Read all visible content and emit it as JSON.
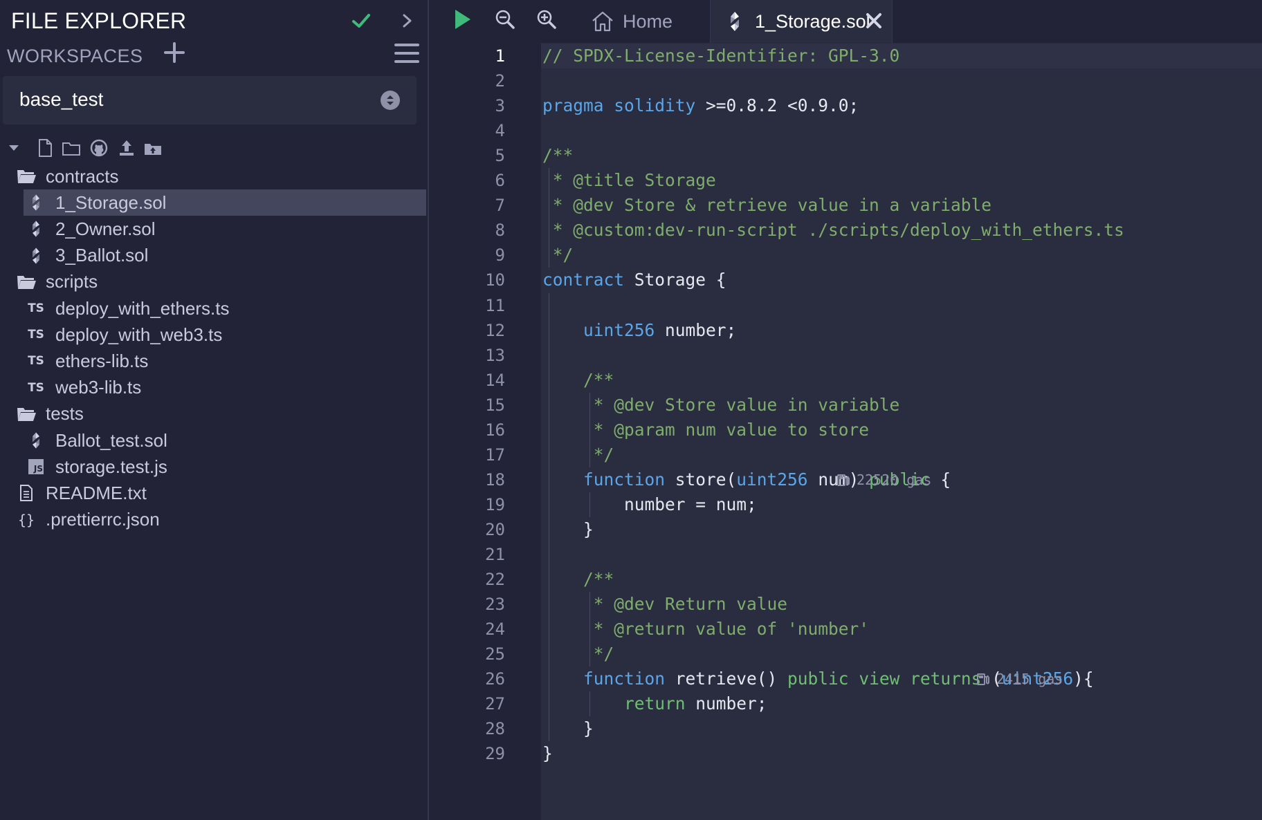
{
  "sidebar": {
    "title": "FILE EXPLORER",
    "workspaces_label": "WORKSPACES",
    "workspace_selected": "base_test",
    "tree": [
      {
        "label": "contracts",
        "type": "folder",
        "depth": 0
      },
      {
        "label": "1_Storage.sol",
        "type": "sol",
        "depth": 1,
        "selected": true
      },
      {
        "label": "2_Owner.sol",
        "type": "sol",
        "depth": 1
      },
      {
        "label": "3_Ballot.sol",
        "type": "sol",
        "depth": 1
      },
      {
        "label": "scripts",
        "type": "folder",
        "depth": 0
      },
      {
        "label": "deploy_with_ethers.ts",
        "type": "ts",
        "depth": 1
      },
      {
        "label": "deploy_with_web3.ts",
        "type": "ts",
        "depth": 1
      },
      {
        "label": "ethers-lib.ts",
        "type": "ts",
        "depth": 1
      },
      {
        "label": "web3-lib.ts",
        "type": "ts",
        "depth": 1
      },
      {
        "label": "tests",
        "type": "folder",
        "depth": 0
      },
      {
        "label": "Ballot_test.sol",
        "type": "sol",
        "depth": 1
      },
      {
        "label": "storage.test.js",
        "type": "js",
        "depth": 1
      },
      {
        "label": "README.txt",
        "type": "txt",
        "depth": 0
      },
      {
        "label": ".prettierrc.json",
        "type": "json",
        "depth": 0
      }
    ]
  },
  "tabs": {
    "home": "Home",
    "active": "1_Storage.sol"
  },
  "editor": {
    "active_line": 1,
    "gas_18": "22520 gas",
    "gas_26": "2415 gas",
    "lines": [
      "// SPDX-License-Identifier: GPL-3.0",
      "",
      "pragma solidity >=0.8.2 <0.9.0;",
      "",
      "/**",
      " * @title Storage",
      " * @dev Store & retrieve value in a variable",
      " * @custom:dev-run-script ./scripts/deploy_with_ethers.ts",
      " */",
      "contract Storage {",
      "",
      "    uint256 number;",
      "",
      "    /**",
      "     * @dev Store value in variable",
      "     * @param num value to store",
      "     */",
      "    function store(uint256 num) public {",
      "        number = num;",
      "    }",
      "",
      "    /**",
      "     * @dev Return value",
      "     * @return value of 'number'",
      "     */",
      "    function retrieve() public view returns (uint256){",
      "        return number;",
      "    }",
      "}"
    ]
  },
  "colors": {
    "bg": "#222336",
    "editor_bg": "#2a2c3f",
    "comment": "#7fad6c",
    "keyword": "#5aa6e8",
    "keyword2": "#6fbf73",
    "run_green": "#3fba7a",
    "check_green": "#3fba7a"
  },
  "icons": {
    "run": "play-icon",
    "zoom_out": "zoom-out-icon",
    "zoom_in": "zoom-in-icon",
    "home": "home-icon",
    "solidity": "solidity-icon",
    "close": "close-icon"
  }
}
